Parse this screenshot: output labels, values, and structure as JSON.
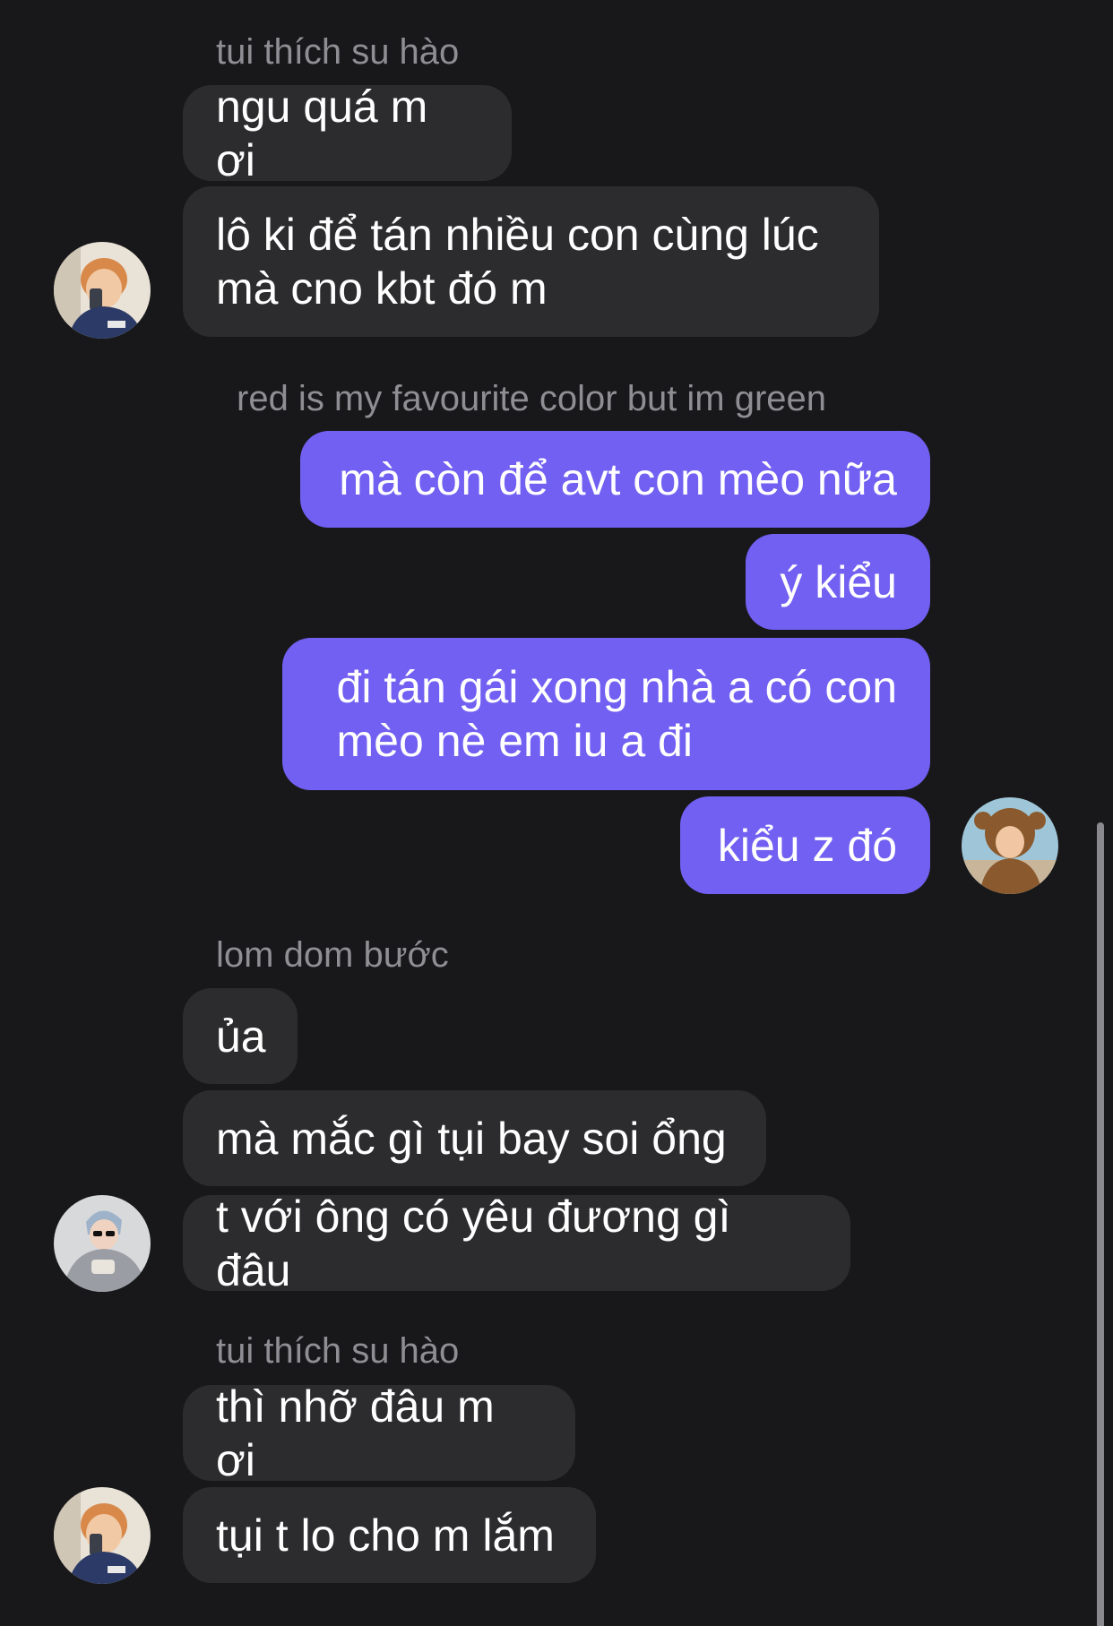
{
  "messages": {
    "sender_1": "tui thích su hào",
    "m1": "ngu quá m ơi",
    "m2": "lô ki để tán nhiều con cùng lúc\nmà cno kbt đó m",
    "sender_2": "red is my favourite color but im green",
    "m3": "mà còn để avt con mèo nữa",
    "m4": "ý kiểu",
    "m5": "đi tán gái xong nhà a có con\nmèo nè em iu a đi",
    "m6": "kiểu z đó",
    "sender_3": "lom dom bước",
    "m7": "ủa",
    "m8": "mà mắc gì tụi bay soi ổng",
    "m9": "t với ông có yêu đương gì đâu",
    "sender_4": "tui thích su hào",
    "m10": "thì nhỡ đâu m ơi",
    "m11": "tụi t lo cho m lắm"
  },
  "colors": {
    "background": "#18181a",
    "incoming_bubble": "#2c2c2e",
    "outgoing_bubble": "#7160f2",
    "sender_name": "#8e8e93"
  }
}
